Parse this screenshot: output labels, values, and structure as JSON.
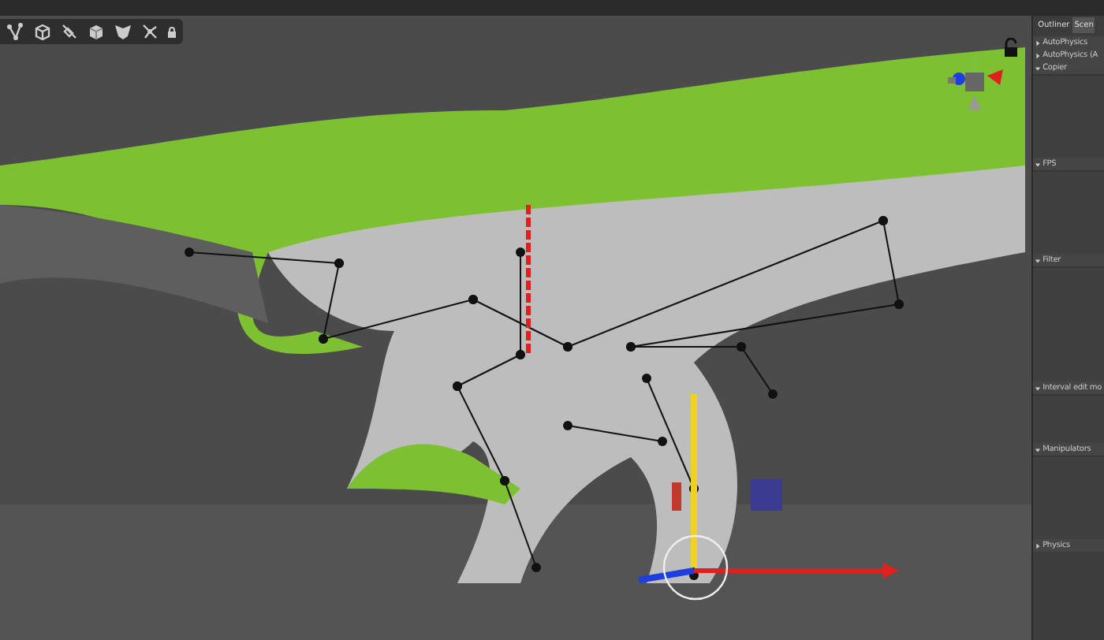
{
  "outliner": {
    "tabs": [
      {
        "label": "Outliner",
        "selected": true
      },
      {
        "label": "Scen",
        "selected": false
      }
    ],
    "sections": [
      {
        "label": "AutoPhysics",
        "expanded": false
      },
      {
        "label": "AutoPhysics (A",
        "expanded": false
      },
      {
        "label": "Copier",
        "expanded": true
      },
      {
        "label": "FPS",
        "expanded": true
      },
      {
        "label": "Filter",
        "expanded": true
      },
      {
        "label": "Interval edit mo",
        "expanded": true
      },
      {
        "label": "Manipulators",
        "expanded": true
      },
      {
        "label": "Physics",
        "expanded": false
      }
    ]
  }
}
